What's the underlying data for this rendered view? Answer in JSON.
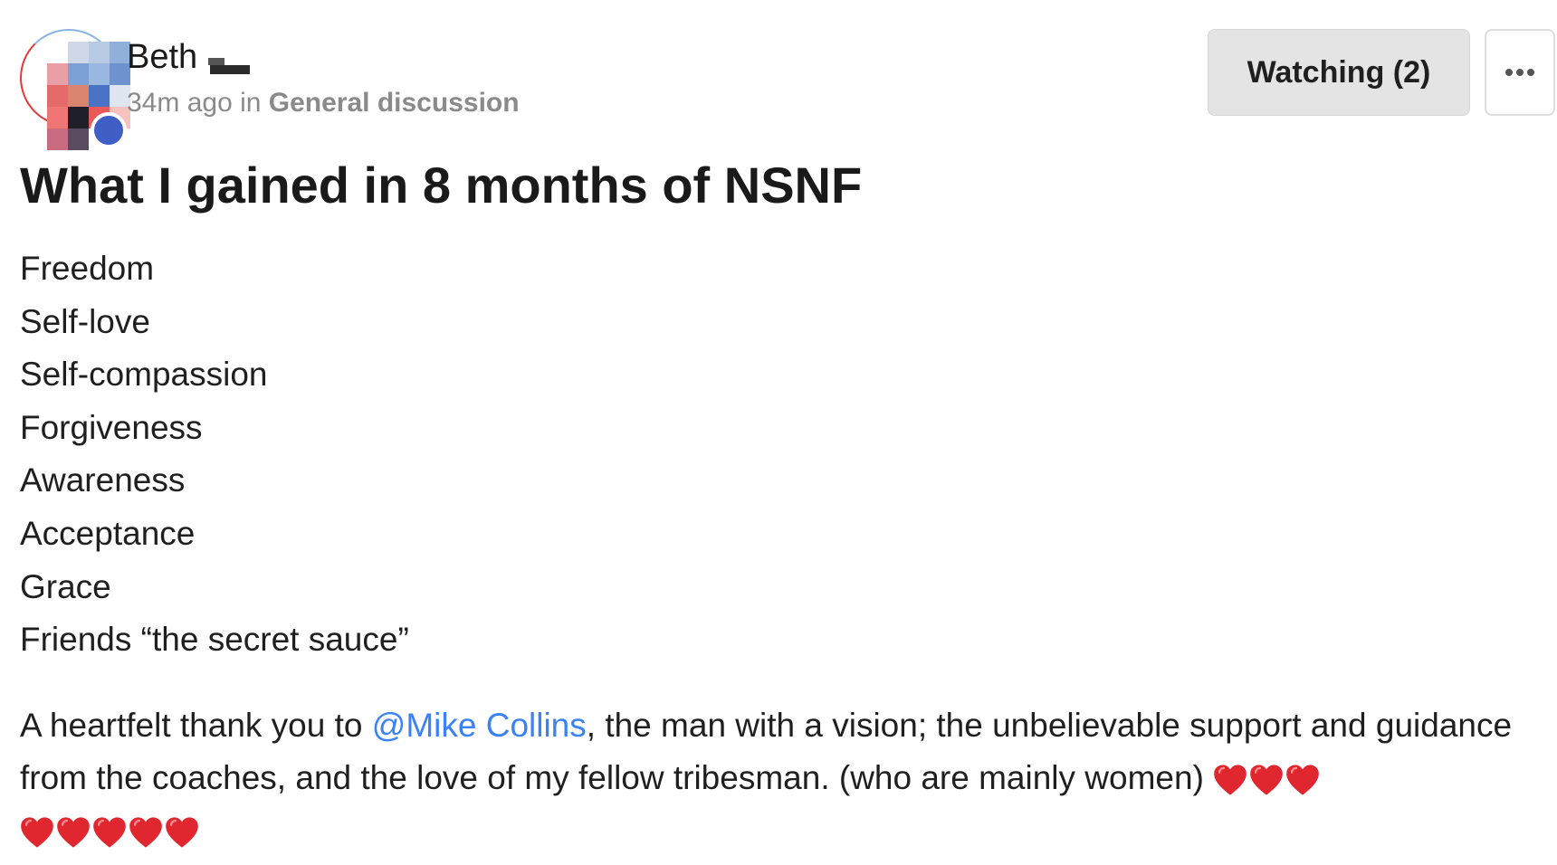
{
  "post": {
    "author": {
      "name": "Beth",
      "avatar_icon": "user-avatar-icon"
    },
    "meta": {
      "time_ago": "34m ago",
      "in_word": " in ",
      "group": "General discussion"
    },
    "actions": {
      "watching_label": "Watching (2)",
      "more_icon": "ellipsis-icon"
    },
    "title": "What I gained in 8 months of NSNF",
    "gains": [
      "Freedom",
      "Self-love",
      "Self-compassion",
      "Forgiveness",
      "Awareness",
      "Acceptance",
      "Grace",
      "Friends “the secret sauce”"
    ],
    "thanks": {
      "before_mention": "A heartfelt thank you to ",
      "mention": "@Mike Collins",
      "after_mention": ", the man with a vision; the unbelievable support and guidance from the coaches, and the love of my fellow tribesman. (who are mainly women) ",
      "heart_icon": "red-heart-icon",
      "heart_count_first_line": 3,
      "heart_count_second_line": 5
    }
  },
  "colors": {
    "mention": "#3b82f6",
    "watch_button_bg": "#e4e4e4",
    "meta_text": "#8a8a8a",
    "heart": "#e0262e"
  }
}
